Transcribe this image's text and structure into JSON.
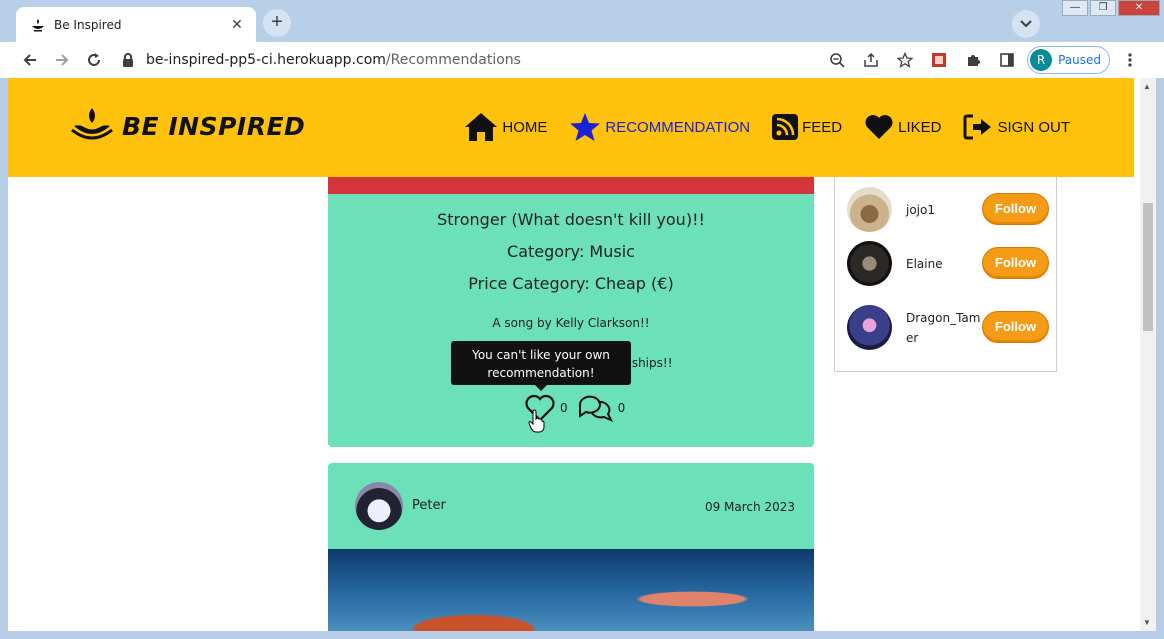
{
  "browser": {
    "tab_title": "Be Inspired",
    "url_host": "be-inspired-pp5-ci.herokuapp.com",
    "url_path": "/Recommendations",
    "profile_initial": "R",
    "profile_status": "Paused"
  },
  "navbar": {
    "brand": "BE INSPIRED",
    "links": [
      {
        "label": "HOME",
        "icon": "home-icon"
      },
      {
        "label": "RECOMMENDATION",
        "icon": "star-icon",
        "active": true
      },
      {
        "label": "FEED",
        "icon": "rss-icon"
      },
      {
        "label": "LIKED",
        "icon": "heart-icon"
      },
      {
        "label": "SIGN OUT",
        "icon": "sign-out-icon"
      }
    ],
    "bg_color": "#fec10c",
    "active_color": "#1b22d6"
  },
  "post1": {
    "title": "Stronger (What doesn't kill you)!!",
    "category": "Category: Music",
    "price": "Price Category: Cheap (€)",
    "description": "A song by Kelly Clarkson!!",
    "description_tail": "rdships!!",
    "tooltip": "You can't like your own recommendation!",
    "likes": "0",
    "comments": "0"
  },
  "post2": {
    "author": "Peter",
    "date": "09 March 2023"
  },
  "sidebar": {
    "profiles": [
      {
        "name": "jojo1",
        "follow": "Follow"
      },
      {
        "name": "Elaine",
        "follow": "Follow"
      },
      {
        "name": "Dragon_Tamer",
        "follow": "Follow"
      }
    ]
  },
  "colors": {
    "card": "#6ce0b8",
    "follow": "#f49b18"
  }
}
